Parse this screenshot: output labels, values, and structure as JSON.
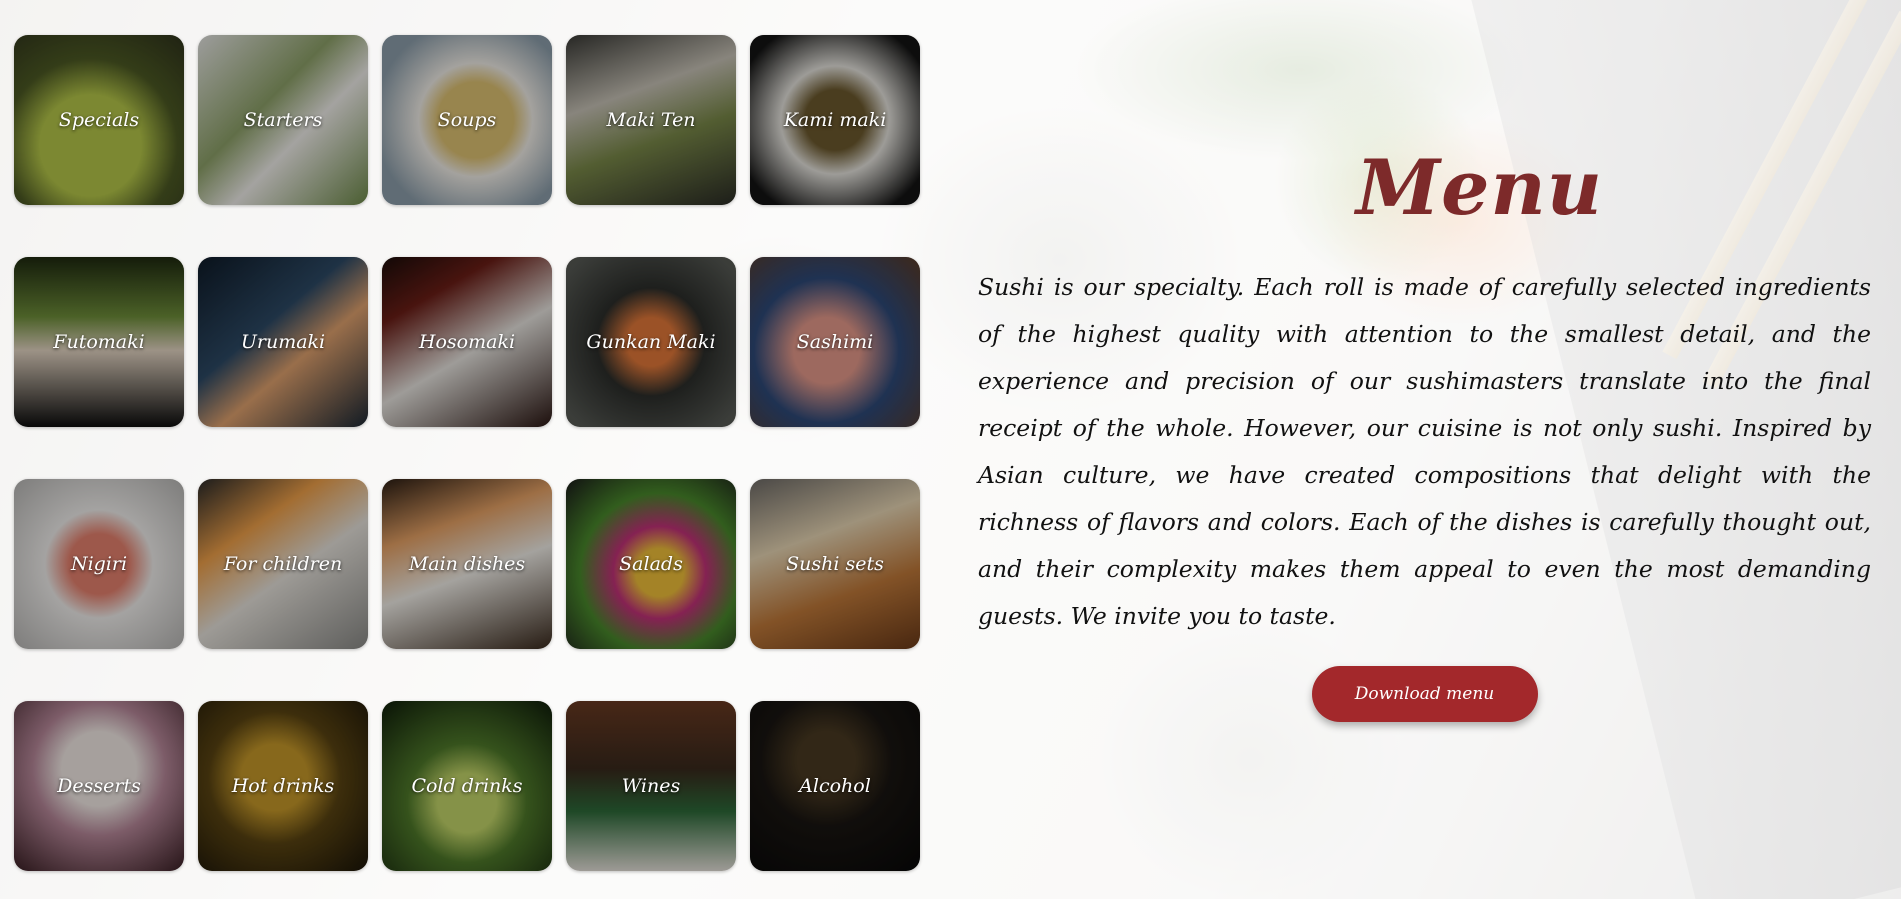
{
  "menu": {
    "title": "Menu",
    "description": "Sushi is our specialty. Each roll is made of carefully selected ingredients of the highest quality with attention to the smallest detail, and the experience and precision of our sushimasters translate into the final receipt of the whole. However, our cuisine is not only sushi. Inspired by Asian culture, we have created compositions that delight with the richness of flavors and colors. Each of the dishes is carefully thought out, and their complexity makes them appeal to even the most demanding guests. We invite you to taste.",
    "download_label": "Download menu"
  },
  "colors": {
    "title": "#7d2a2a",
    "button": "#a3282b"
  },
  "categories": [
    {
      "label": "Specials"
    },
    {
      "label": "Starters"
    },
    {
      "label": "Soups"
    },
    {
      "label": "Maki Ten"
    },
    {
      "label": "Kami maki"
    },
    {
      "label": "Futomaki"
    },
    {
      "label": "Urumaki"
    },
    {
      "label": "Hosomaki"
    },
    {
      "label": "Gunkan Maki"
    },
    {
      "label": "Sashimi"
    },
    {
      "label": "Nigiri"
    },
    {
      "label": "For children"
    },
    {
      "label": "Main dishes"
    },
    {
      "label": "Salads"
    },
    {
      "label": "Sushi sets"
    },
    {
      "label": "Desserts"
    },
    {
      "label": "Hot drinks"
    },
    {
      "label": "Cold drinks"
    },
    {
      "label": "Wines"
    },
    {
      "label": "Alcohol"
    }
  ]
}
